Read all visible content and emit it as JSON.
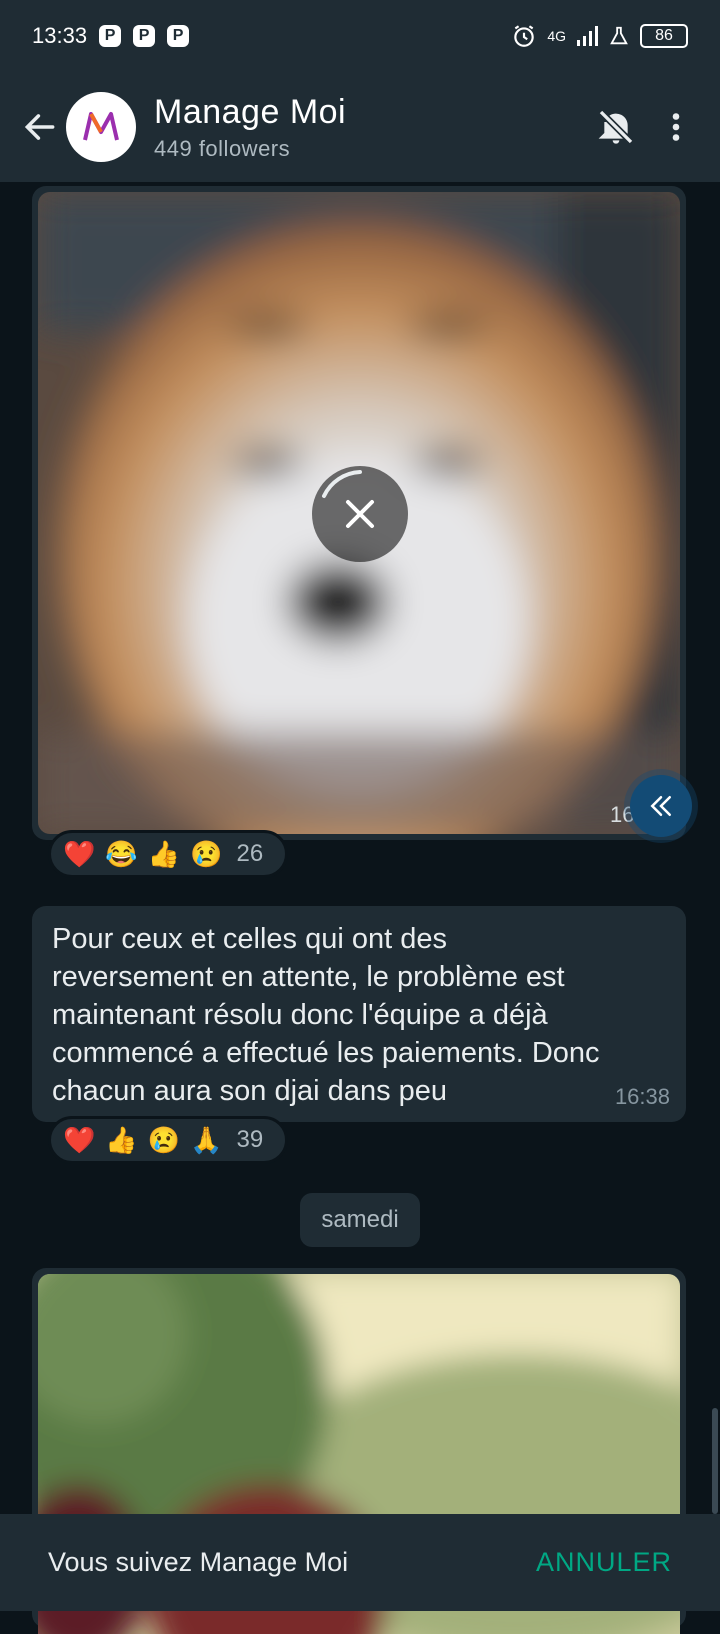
{
  "status_bar": {
    "time": "13:33",
    "notif_icons": [
      "P",
      "P",
      "P"
    ],
    "network": "4G",
    "battery": "86"
  },
  "header": {
    "title": "Manage Moi",
    "subtitle": "449 followers",
    "avatar_text": "M"
  },
  "messages": [
    {
      "type": "media",
      "time": "16",
      "reactions": [
        "❤️",
        "😂",
        "👍",
        "😢"
      ],
      "reaction_count": "26"
    },
    {
      "type": "text",
      "text": "Pour ceux et celles qui ont des\nreversement en attente, le problème est\nmaintenant résolu donc l'équipe a déjà\ncommencé a effectué les paiements. Donc\nchacun aura son djai dans peu",
      "time": "16:38",
      "reactions": [
        "❤️",
        "👍",
        "😢",
        "🙏"
      ],
      "reaction_count": "39"
    }
  ],
  "date_separator": "samedi",
  "bottom_bar": {
    "text": "Vous suivez Manage Moi",
    "action": "ANNULER"
  },
  "colors": {
    "background": "#0b141a",
    "panel": "#1f2c34",
    "accent": "#00a884",
    "scroll_button": "#134b75"
  }
}
